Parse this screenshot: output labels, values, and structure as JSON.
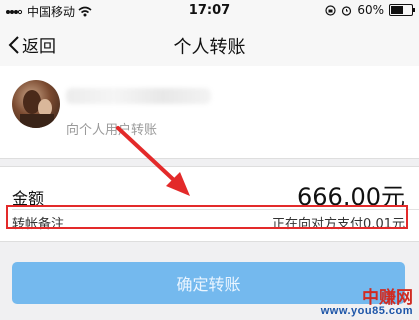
{
  "status_bar": {
    "carrier": "中国移动",
    "time": "17:07",
    "battery": "60%",
    "battery_level": 0.6,
    "icons": [
      "signal-icon",
      "wifi-icon",
      "lock-rotation-icon",
      "alarm-icon",
      "battery-icon"
    ]
  },
  "nav": {
    "back_label": "返回",
    "title": "个人转账"
  },
  "payee": {
    "subtitle": "向个人用户转账"
  },
  "amount": {
    "label": "金额",
    "value": "666.00元"
  },
  "remark": {
    "label": "转帐备注",
    "value": "正在向对方支付0.01元"
  },
  "confirm": {
    "label": "确定转账"
  },
  "watermark": {
    "top": "中赚网",
    "bottom": "www.you85.com"
  },
  "colors": {
    "annotation": "#e32a2a",
    "button": "#74b9ee",
    "background": "#f0f0f2"
  }
}
